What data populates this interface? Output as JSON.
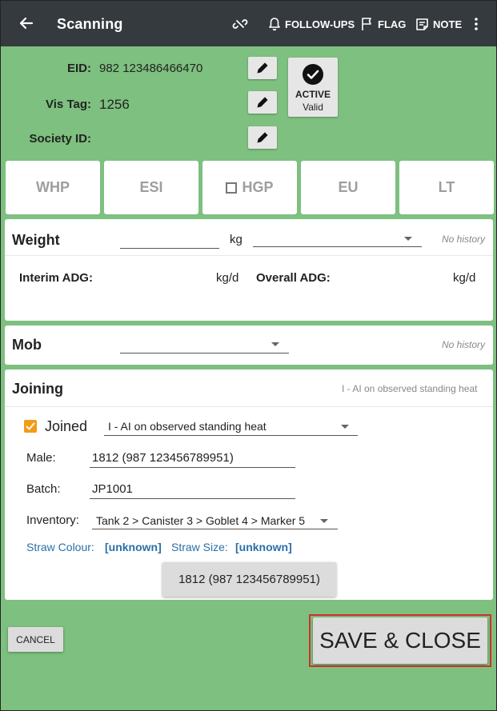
{
  "appbar": {
    "title": "Scanning",
    "follow_ups": "FOLLOW-UPS",
    "flag": "FLAG",
    "note": "NOTE",
    "icons": [
      "back-arrow-icon",
      "unlink-icon",
      "bell-icon",
      "flag-icon",
      "note-icon",
      "more-vert-icon"
    ],
    "bg_color": "#353a3f"
  },
  "identity": {
    "eid_label": "EID:",
    "eid_value": "982 123486466470",
    "vistag_label": "Vis Tag:",
    "vistag_value": "1256",
    "society_label": "Society ID:",
    "society_value": "",
    "status_label": "ACTIVE",
    "status_sub": "Valid"
  },
  "tags": [
    {
      "label": "WHP"
    },
    {
      "label": "ESI"
    },
    {
      "label": "HGP",
      "checkbox": true
    },
    {
      "label": "EU"
    },
    {
      "label": "LT"
    }
  ],
  "weight": {
    "title": "Weight",
    "unit": "kg",
    "history": "No history",
    "interim_label": "Interim ADG:",
    "interim_unit": "kg/d",
    "overall_label": "Overall ADG:",
    "overall_unit": "kg/d"
  },
  "mob": {
    "title": "Mob",
    "history": "No history"
  },
  "joining": {
    "title": "Joining",
    "summary": "I - AI on observed standing heat",
    "joined_label": "Joined",
    "joined_checked": true,
    "method_value": "I - AI on observed standing heat",
    "male_label": "Male:",
    "male_value": "1812 (987 123456789951)",
    "batch_label": "Batch:",
    "batch_value": "JP1001",
    "inventory_label": "Inventory:",
    "inventory_value": "Tank 2 > Canister 3 > Goblet 4 > Marker 5",
    "straw_colour_label": "Straw Colour:",
    "straw_colour_value": "[unknown]",
    "straw_size_label": "Straw Size:",
    "straw_size_value": "[unknown]",
    "sire_button": "1812 (987 123456789951)"
  },
  "footer": {
    "cancel": "CANCEL",
    "save": "SAVE & CLOSE",
    "highlight_color": "#d32f2f"
  },
  "colors": {
    "background": "#7dc07f",
    "checkbox": "#f39c12",
    "link_blue": "#2a6fa8"
  }
}
